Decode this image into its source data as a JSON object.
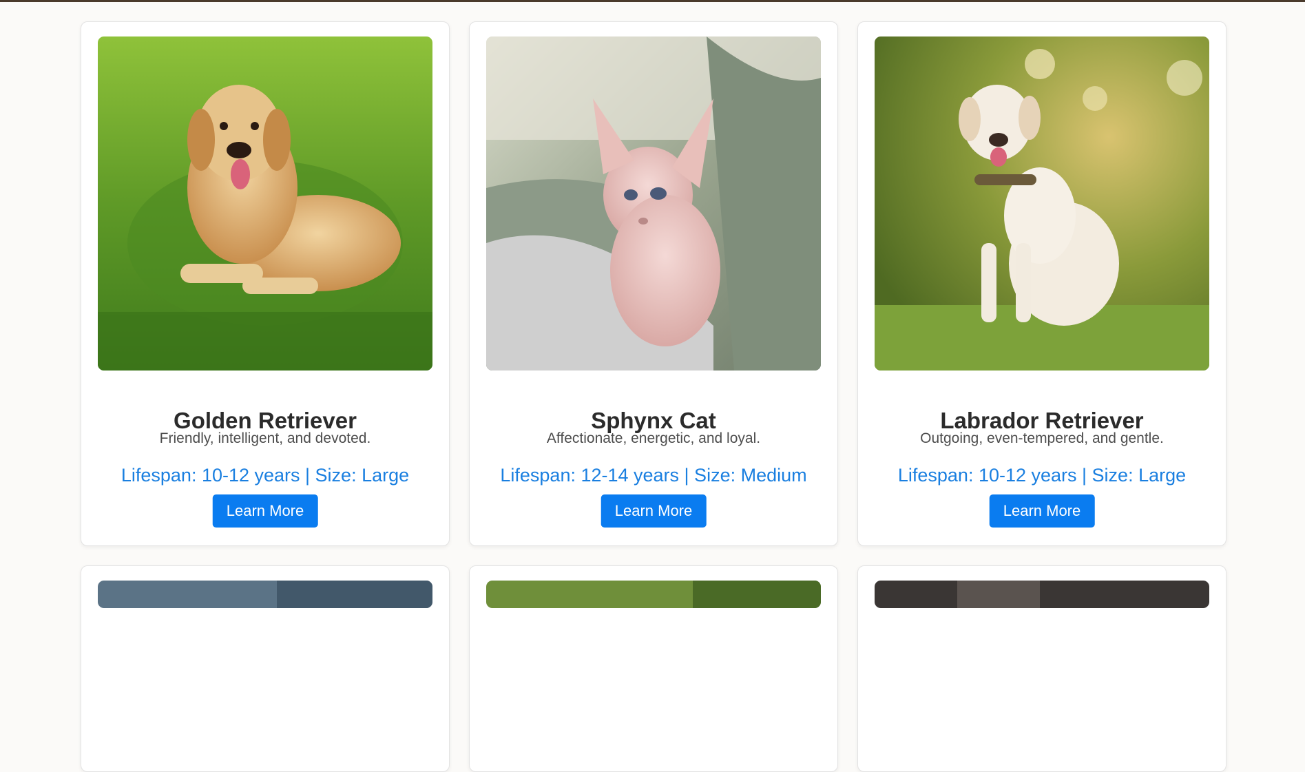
{
  "cards": [
    {
      "name": "Golden Retriever",
      "description": "Friendly, intelligent, and devoted.",
      "meta": "Lifespan: 10-12 years | Size: Large",
      "button_label": "Learn More",
      "image": "golden-retriever-photo"
    },
    {
      "name": "Sphynx Cat",
      "description": "Affectionate, energetic, and loyal.",
      "meta": "Lifespan: 12-14 years | Size: Medium",
      "button_label": "Learn More",
      "image": "sphynx-cat-photo"
    },
    {
      "name": "Labrador Retriever",
      "description": "Outgoing, even-tempered, and gentle.",
      "meta": "Lifespan: 10-12 years | Size: Large",
      "button_label": "Learn More",
      "image": "labrador-retriever-photo"
    }
  ],
  "colors": {
    "accent": "#0a7cf0",
    "meta_text": "#1a7fe0",
    "title_text": "#2b2b2b",
    "header_bar": "#4a3a2c"
  }
}
